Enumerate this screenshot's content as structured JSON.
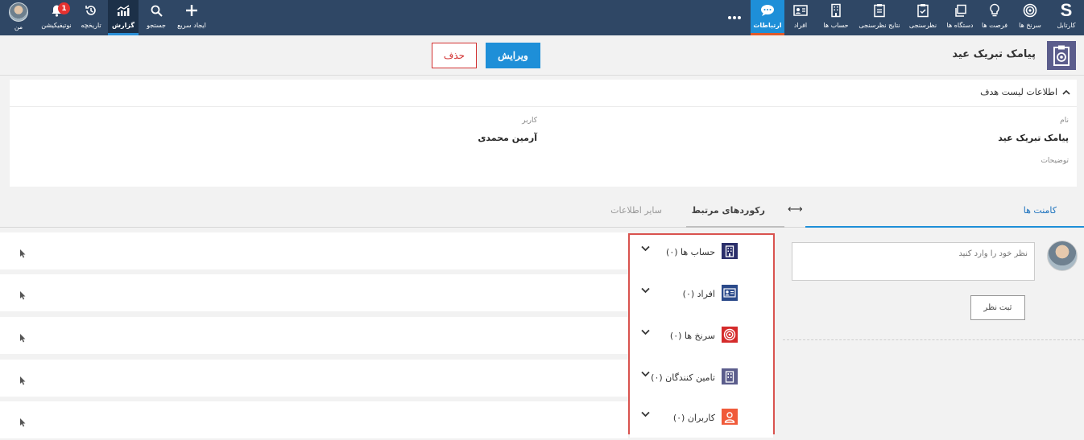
{
  "nav": {
    "items": [
      {
        "key": "portal",
        "label": "کارتابل",
        "icon": "brand-s-icon"
      },
      {
        "key": "leads",
        "label": "سرنخ ها",
        "icon": "target-icon"
      },
      {
        "key": "opportunities",
        "label": "فرصت ها",
        "icon": "lightbulb-icon"
      },
      {
        "key": "devices",
        "label": "دستگاه ها",
        "icon": "copy-icon"
      },
      {
        "key": "surveys",
        "label": "نظرسنجی",
        "icon": "clipboard-check-icon"
      },
      {
        "key": "survey_results",
        "label": "نتایج نظرسنجی",
        "icon": "clipboard-icon"
      },
      {
        "key": "accounts",
        "label": "حساب ها",
        "icon": "building-icon"
      },
      {
        "key": "people",
        "label": "افراد",
        "icon": "id-card-icon"
      },
      {
        "key": "communications",
        "label": "ارتباطات",
        "icon": "chat-icon"
      },
      {
        "key": "more",
        "label": "",
        "icon": "more-icon"
      },
      {
        "key": "quick_create",
        "label": "ایجاد سریع",
        "icon": "plus-icon"
      },
      {
        "key": "search",
        "label": "جستجو",
        "icon": "search-icon"
      },
      {
        "key": "reports",
        "label": "گزارش",
        "icon": "chart-icon"
      },
      {
        "key": "history",
        "label": "تاریخچه",
        "icon": "history-icon"
      },
      {
        "key": "notifications",
        "label": "نوتیفیکیشن",
        "icon": "bell-icon"
      },
      {
        "key": "me",
        "label": "من",
        "icon": "avatar"
      }
    ],
    "notification_count": "1"
  },
  "record": {
    "title": "پیامک تبریک عید",
    "edit_label": "ویرایش",
    "delete_label": "حذف"
  },
  "info": {
    "section_title": "اطلاعات لیست هدف",
    "name_label": "نام",
    "name_value": "پیامک تبریک عید",
    "user_label": "کاربر",
    "user_value": "آرمین محمدی",
    "description_label": "توضیحات"
  },
  "tabs": {
    "comments": "کامنت ها",
    "related": "رکوردهای مرتبط",
    "other": "سایر اطلاعات"
  },
  "related": [
    {
      "label": "حساب ها (۰)",
      "icon": "building-icon",
      "color": "#2b2f6b"
    },
    {
      "label": "افراد (۰)",
      "icon": "id-card-icon",
      "color": "#2b4a8a"
    },
    {
      "label": "سرنخ ها (۰)",
      "icon": "target-icon",
      "color": "#d52b2b"
    },
    {
      "label": "تامین کنندگان (۰)",
      "icon": "supplier-icon",
      "color": "#5b5d8c"
    },
    {
      "label": "کاربران (۰)",
      "icon": "user-icon",
      "color": "#f05a3a"
    }
  ],
  "comment": {
    "placeholder": "نظر خود را وارد کنید",
    "submit_label": "ثبت نظر"
  },
  "colors": {
    "nav_bg": "#2f4765",
    "accent": "#1e8fd8",
    "danger": "#d23030"
  }
}
